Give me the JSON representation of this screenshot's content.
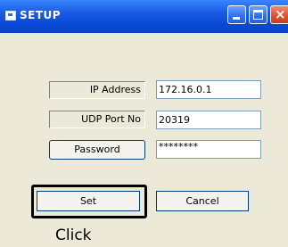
{
  "window": {
    "title": "SETUP",
    "controls": {
      "minimize": "minimize-icon",
      "maximize": "maximize-icon",
      "close": "close-icon",
      "close_glyph": "×"
    }
  },
  "form": {
    "ip": {
      "label": "IP Address",
      "value": "172.16.0.1"
    },
    "udp": {
      "label": "UDP Port No",
      "value": "20319"
    },
    "password": {
      "label": "Password",
      "value": "********"
    }
  },
  "buttons": {
    "set": "Set",
    "cancel": "Cancel"
  },
  "annotation": {
    "click": "Click"
  }
}
